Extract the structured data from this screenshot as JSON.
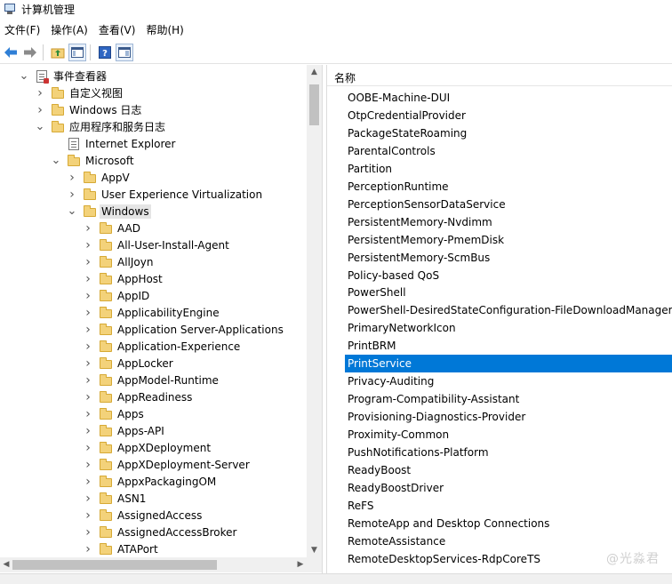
{
  "window": {
    "title": "计算机管理"
  },
  "menu": [
    "文件(F)",
    "操作(A)",
    "查看(V)",
    "帮助(H)"
  ],
  "toolbar": {
    "icons": [
      "back-icon",
      "forward-icon",
      "up-folder-icon",
      "show-hide-console-tree-icon",
      "help-icon",
      "properties-icon"
    ]
  },
  "tree": [
    {
      "label": "事件查看器",
      "depth": 0,
      "expander": "expanded",
      "icon": "logicon-red"
    },
    {
      "label": "自定义视图",
      "depth": 1,
      "expander": "collapsed",
      "icon": "folder"
    },
    {
      "label": "Windows 日志",
      "depth": 1,
      "expander": "collapsed",
      "icon": "folder"
    },
    {
      "label": "应用程序和服务日志",
      "depth": 1,
      "expander": "expanded",
      "icon": "folder"
    },
    {
      "label": "Internet Explorer",
      "depth": 2,
      "expander": "none",
      "icon": "logicon"
    },
    {
      "label": "Microsoft",
      "depth": 2,
      "expander": "expanded",
      "icon": "folder"
    },
    {
      "label": "AppV",
      "depth": 3,
      "expander": "collapsed",
      "icon": "folder"
    },
    {
      "label": "User Experience Virtualization",
      "depth": 3,
      "expander": "collapsed",
      "icon": "folder"
    },
    {
      "label": "Windows",
      "depth": 3,
      "expander": "expanded",
      "icon": "folder",
      "selected": true
    },
    {
      "label": "AAD",
      "depth": 4,
      "expander": "collapsed",
      "icon": "folder"
    },
    {
      "label": "All-User-Install-Agent",
      "depth": 4,
      "expander": "collapsed",
      "icon": "folder"
    },
    {
      "label": "AllJoyn",
      "depth": 4,
      "expander": "collapsed",
      "icon": "folder"
    },
    {
      "label": "AppHost",
      "depth": 4,
      "expander": "collapsed",
      "icon": "folder"
    },
    {
      "label": "AppID",
      "depth": 4,
      "expander": "collapsed",
      "icon": "folder"
    },
    {
      "label": "ApplicabilityEngine",
      "depth": 4,
      "expander": "collapsed",
      "icon": "folder"
    },
    {
      "label": "Application Server-Applications",
      "depth": 4,
      "expander": "collapsed",
      "icon": "folder"
    },
    {
      "label": "Application-Experience",
      "depth": 4,
      "expander": "collapsed",
      "icon": "folder"
    },
    {
      "label": "AppLocker",
      "depth": 4,
      "expander": "collapsed",
      "icon": "folder"
    },
    {
      "label": "AppModel-Runtime",
      "depth": 4,
      "expander": "collapsed",
      "icon": "folder"
    },
    {
      "label": "AppReadiness",
      "depth": 4,
      "expander": "collapsed",
      "icon": "folder"
    },
    {
      "label": "Apps",
      "depth": 4,
      "expander": "collapsed",
      "icon": "folder"
    },
    {
      "label": "Apps-API",
      "depth": 4,
      "expander": "collapsed",
      "icon": "folder"
    },
    {
      "label": "AppXDeployment",
      "depth": 4,
      "expander": "collapsed",
      "icon": "folder"
    },
    {
      "label": "AppXDeployment-Server",
      "depth": 4,
      "expander": "collapsed",
      "icon": "folder"
    },
    {
      "label": "AppxPackagingOM",
      "depth": 4,
      "expander": "collapsed",
      "icon": "folder"
    },
    {
      "label": "ASN1",
      "depth": 4,
      "expander": "collapsed",
      "icon": "folder"
    },
    {
      "label": "AssignedAccess",
      "depth": 4,
      "expander": "collapsed",
      "icon": "folder"
    },
    {
      "label": "AssignedAccessBroker",
      "depth": 4,
      "expander": "collapsed",
      "icon": "folder"
    },
    {
      "label": "ATAPort",
      "depth": 4,
      "expander": "collapsed",
      "icon": "folder"
    }
  ],
  "list": {
    "header": "名称",
    "items": [
      "OOBE-Machine-DUI",
      "OtpCredentialProvider",
      "PackageStateRoaming",
      "ParentalControls",
      "Partition",
      "PerceptionRuntime",
      "PerceptionSensorDataService",
      "PersistentMemory-Nvdimm",
      "PersistentMemory-PmemDisk",
      "PersistentMemory-ScmBus",
      "Policy-based QoS",
      "PowerShell",
      "PowerShell-DesiredStateConfiguration-FileDownloadManager",
      "PrimaryNetworkIcon",
      "PrintBRM",
      "PrintService",
      "Privacy-Auditing",
      "Program-Compatibility-Assistant",
      "Provisioning-Diagnostics-Provider",
      "Proximity-Common",
      "PushNotifications-Platform",
      "ReadyBoost",
      "ReadyBoostDriver",
      "ReFS",
      "RemoteApp and Desktop Connections",
      "RemoteAssistance",
      "RemoteDesktopServices-RdpCoreTS"
    ],
    "selected_item": "PrintService"
  },
  "watermark": "@光淼君",
  "colors": {
    "selection": "#0078d7",
    "tree_selection": "#e5e5e5",
    "folder": "#f3d27a"
  }
}
